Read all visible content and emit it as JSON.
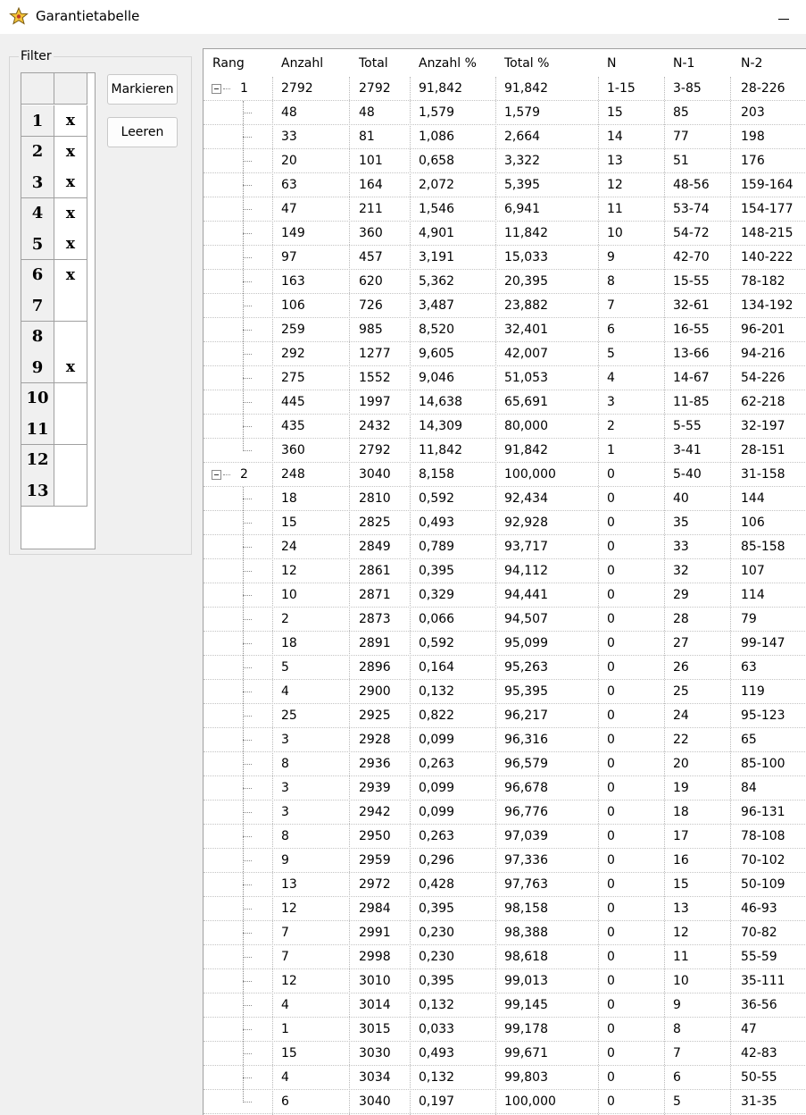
{
  "window": {
    "title": "Garantietabelle",
    "icon": "star-app-icon"
  },
  "filter": {
    "legend": "Filter",
    "rows": [
      {
        "num": "1",
        "mark": "x"
      },
      {
        "num": "2",
        "mark": "x"
      },
      {
        "num": "3",
        "mark": "x"
      },
      {
        "num": "4",
        "mark": "x"
      },
      {
        "num": "5",
        "mark": "x"
      },
      {
        "num": "6",
        "mark": "x"
      },
      {
        "num": "7",
        "mark": ""
      },
      {
        "num": "8",
        "mark": ""
      },
      {
        "num": "9",
        "mark": "x"
      },
      {
        "num": "10",
        "mark": ""
      },
      {
        "num": "11",
        "mark": ""
      },
      {
        "num": "12",
        "mark": ""
      },
      {
        "num": "13",
        "mark": ""
      }
    ],
    "markieren_label": "Markieren",
    "leeren_label": "Leeren"
  },
  "table": {
    "columns": [
      "Rang",
      "Anzahl",
      "Total",
      "Anzahl %",
      "Total %",
      "N",
      "N-1",
      "N-2"
    ],
    "groups": [
      {
        "rang": "1",
        "summary": [
          "2792",
          "2792",
          "91,842",
          "91,842",
          "1-15",
          "3-85",
          "28-226"
        ],
        "rows": [
          [
            "48",
            "48",
            "1,579",
            "1,579",
            "15",
            "85",
            "203"
          ],
          [
            "33",
            "81",
            "1,086",
            "2,664",
            "14",
            "77",
            "198"
          ],
          [
            "20",
            "101",
            "0,658",
            "3,322",
            "13",
            "51",
            "176"
          ],
          [
            "63",
            "164",
            "2,072",
            "5,395",
            "12",
            "48-56",
            "159-164"
          ],
          [
            "47",
            "211",
            "1,546",
            "6,941",
            "11",
            "53-74",
            "154-177"
          ],
          [
            "149",
            "360",
            "4,901",
            "11,842",
            "10",
            "54-72",
            "148-215"
          ],
          [
            "97",
            "457",
            "3,191",
            "15,033",
            "9",
            "42-70",
            "140-222"
          ],
          [
            "163",
            "620",
            "5,362",
            "20,395",
            "8",
            "15-55",
            "78-182"
          ],
          [
            "106",
            "726",
            "3,487",
            "23,882",
            "7",
            "32-61",
            "134-192"
          ],
          [
            "259",
            "985",
            "8,520",
            "32,401",
            "6",
            "16-55",
            "96-201"
          ],
          [
            "292",
            "1277",
            "9,605",
            "42,007",
            "5",
            "13-66",
            "94-216"
          ],
          [
            "275",
            "1552",
            "9,046",
            "51,053",
            "4",
            "14-67",
            "54-226"
          ],
          [
            "445",
            "1997",
            "14,638",
            "65,691",
            "3",
            "11-85",
            "62-218"
          ],
          [
            "435",
            "2432",
            "14,309",
            "80,000",
            "2",
            "5-55",
            "32-197"
          ],
          [
            "360",
            "2792",
            "11,842",
            "91,842",
            "1",
            "3-41",
            "28-151"
          ]
        ]
      },
      {
        "rang": "2",
        "summary": [
          "248",
          "3040",
          "8,158",
          "100,000",
          "0",
          "5-40",
          "31-158"
        ],
        "rows": [
          [
            "18",
            "2810",
            "0,592",
            "92,434",
            "0",
            "40",
            "144"
          ],
          [
            "15",
            "2825",
            "0,493",
            "92,928",
            "0",
            "35",
            "106"
          ],
          [
            "24",
            "2849",
            "0,789",
            "93,717",
            "0",
            "33",
            "85-158"
          ],
          [
            "12",
            "2861",
            "0,395",
            "94,112",
            "0",
            "32",
            "107"
          ],
          [
            "10",
            "2871",
            "0,329",
            "94,441",
            "0",
            "29",
            "114"
          ],
          [
            "2",
            "2873",
            "0,066",
            "94,507",
            "0",
            "28",
            "79"
          ],
          [
            "18",
            "2891",
            "0,592",
            "95,099",
            "0",
            "27",
            "99-147"
          ],
          [
            "5",
            "2896",
            "0,164",
            "95,263",
            "0",
            "26",
            "63"
          ],
          [
            "4",
            "2900",
            "0,132",
            "95,395",
            "0",
            "25",
            "119"
          ],
          [
            "25",
            "2925",
            "0,822",
            "96,217",
            "0",
            "24",
            "95-123"
          ],
          [
            "3",
            "2928",
            "0,099",
            "96,316",
            "0",
            "22",
            "65"
          ],
          [
            "8",
            "2936",
            "0,263",
            "96,579",
            "0",
            "20",
            "85-100"
          ],
          [
            "3",
            "2939",
            "0,099",
            "96,678",
            "0",
            "19",
            "84"
          ],
          [
            "3",
            "2942",
            "0,099",
            "96,776",
            "0",
            "18",
            "96-131"
          ],
          [
            "8",
            "2950",
            "0,263",
            "97,039",
            "0",
            "17",
            "78-108"
          ],
          [
            "9",
            "2959",
            "0,296",
            "97,336",
            "0",
            "16",
            "70-102"
          ],
          [
            "13",
            "2972",
            "0,428",
            "97,763",
            "0",
            "15",
            "50-109"
          ],
          [
            "12",
            "2984",
            "0,395",
            "98,158",
            "0",
            "13",
            "46-93"
          ],
          [
            "7",
            "2991",
            "0,230",
            "98,388",
            "0",
            "12",
            "70-82"
          ],
          [
            "7",
            "2998",
            "0,230",
            "98,618",
            "0",
            "11",
            "55-59"
          ],
          [
            "12",
            "3010",
            "0,395",
            "99,013",
            "0",
            "10",
            "35-111"
          ],
          [
            "4",
            "3014",
            "0,132",
            "99,145",
            "0",
            "9",
            "36-56"
          ],
          [
            "1",
            "3015",
            "0,033",
            "99,178",
            "0",
            "8",
            "47"
          ],
          [
            "15",
            "3030",
            "0,493",
            "99,671",
            "0",
            "7",
            "42-83"
          ],
          [
            "4",
            "3034",
            "0,132",
            "99,803",
            "0",
            "6",
            "50-55"
          ],
          [
            "6",
            "3040",
            "0,197",
            "100,000",
            "0",
            "5",
            "31-35"
          ]
        ]
      }
    ]
  }
}
